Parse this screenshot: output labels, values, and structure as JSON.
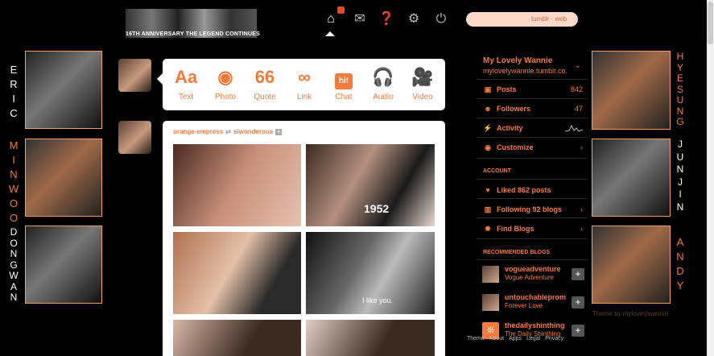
{
  "banner": {
    "caption": "16TH ANNIVERSARY  THE LEGEND CONTINUES"
  },
  "nav": {
    "home_icon": "home-icon",
    "notification_count": "",
    "search_placeholder": "tumblr · web"
  },
  "left_names": {
    "eric": [
      "E",
      "R",
      "I",
      "C"
    ],
    "minwoo": [
      "M",
      "I",
      "N",
      "W",
      "O",
      "O"
    ],
    "dongwan": [
      "D",
      "O",
      "N",
      "G",
      "W",
      "A",
      "N"
    ]
  },
  "right_names": {
    "hyesung": [
      "H",
      "Y",
      "E",
      "S",
      "U",
      "N",
      "G"
    ],
    "junjin": [
      "J",
      "U",
      "N",
      "J",
      "I",
      "N"
    ],
    "andy": [
      "A",
      "N",
      "D",
      "Y"
    ]
  },
  "post_types": [
    {
      "icon": "Aa",
      "label": "Text"
    },
    {
      "icon": "◉",
      "label": "Photo"
    },
    {
      "icon": "66",
      "label": "Quote"
    },
    {
      "icon": "∞",
      "label": "Link"
    },
    {
      "icon": "hi!",
      "label": "Chat"
    },
    {
      "icon": "🎧",
      "label": "Audio"
    },
    {
      "icon": "🎥",
      "label": "Video"
    }
  ],
  "post": {
    "author": "orange-empress",
    "reblogged_from": "siwonderous",
    "image_text": {
      "jersey": "1952",
      "subtitle": "I like you."
    }
  },
  "sidebar": {
    "blog_title": "My Lovely Wannie",
    "blog_url": "mylovelywannie.tumblr.co...",
    "stats": [
      {
        "label": "Posts",
        "value": "842"
      },
      {
        "label": "Followers",
        "value": "47"
      },
      {
        "label": "Activity",
        "value": ""
      },
      {
        "label": "Customize",
        "value": "›"
      }
    ],
    "account_heading": "ACCOUNT",
    "account": [
      {
        "label": "Liked 862 posts",
        "value": ""
      },
      {
        "label": "Following 92 blogs",
        "value": "›"
      },
      {
        "label": "Find Blogs",
        "value": "›"
      }
    ],
    "recommended_heading": "RECOMMENDED BLOGS",
    "recommended": [
      {
        "name": "vogueadventure",
        "title": "Vogue Adventure"
      },
      {
        "name": "untouchableprom",
        "title": "Forever Love"
      },
      {
        "name": "thedailyshinthing",
        "title": "The Daily Shinthing"
      }
    ]
  },
  "theme_credit": "Theme by mylovelywannie",
  "footer": [
    "Theme",
    "About",
    "Apps",
    "Legal",
    "Privacy"
  ],
  "colors": {
    "accent": "#f47a3d",
    "background": "#000000",
    "search_bg": "#fcd9c9"
  }
}
